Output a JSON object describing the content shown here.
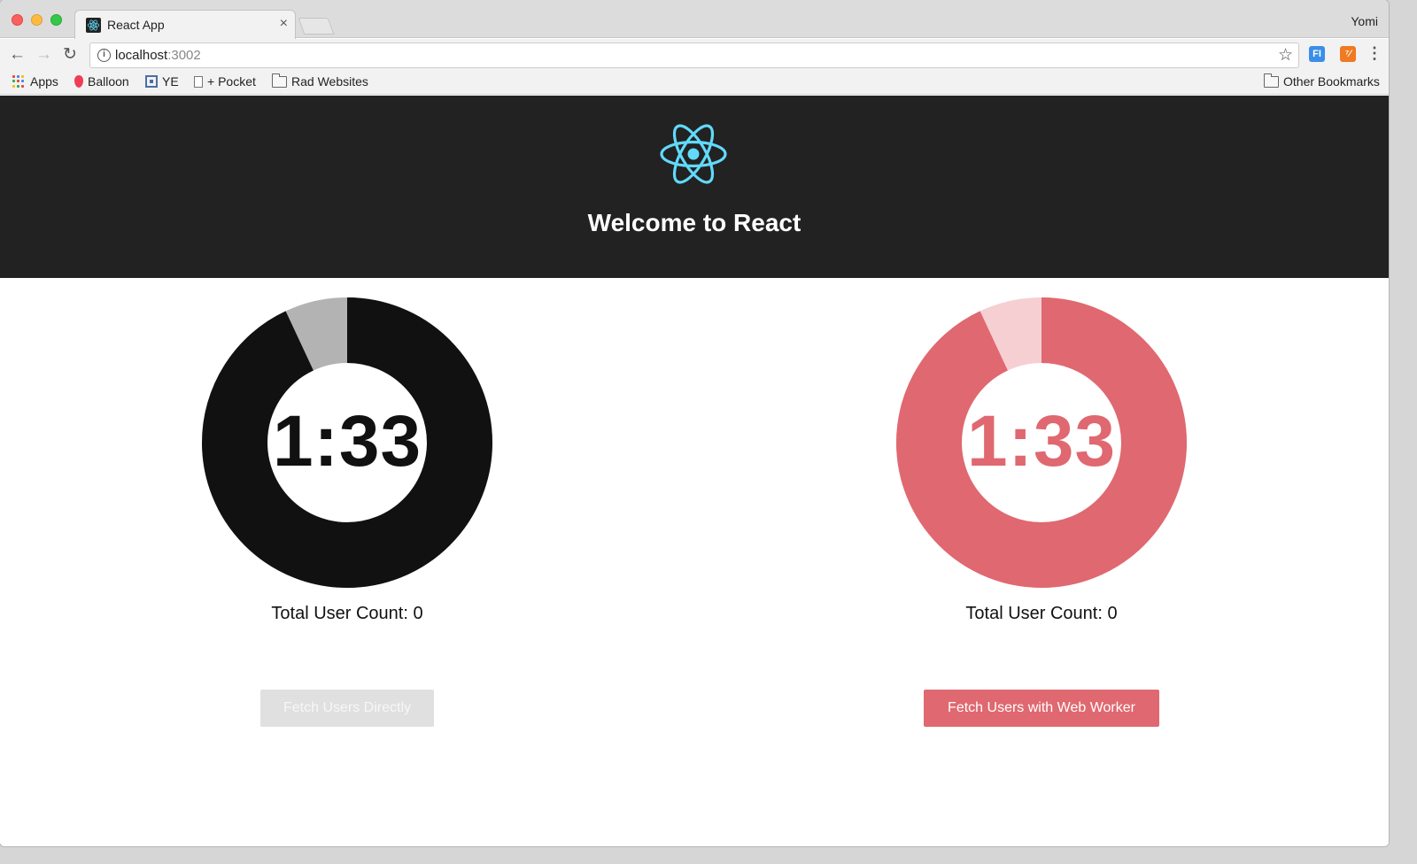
{
  "browser": {
    "tab_title": "React App",
    "tab_close": "×",
    "profile_name": "Yomi",
    "url_host": "localhost",
    "url_port": ":3002",
    "bookmarks": {
      "apps": "Apps",
      "balloon": "Balloon",
      "ye": "YE",
      "pocket": "+ Pocket",
      "rad_websites": "Rad Websites",
      "other_bookmarks": "Other Bookmarks"
    },
    "icons": {
      "back": "←",
      "forward": "→",
      "reload": "↻",
      "star": "☆",
      "menu": "⋮",
      "ext1": "FI",
      "ext2": "⁷⁄"
    }
  },
  "app": {
    "header_title": "Welcome to React",
    "logo_color": "#61dafb",
    "header_bg": "#222222",
    "left_panel": {
      "timer": "1:33",
      "elapsed_fraction": 0.07,
      "count_label": "Total User Count: 0",
      "button_label": "Fetch Users Directly",
      "button_disabled": true,
      "ring_color": "#111111",
      "track_color": "#b3b3b3",
      "timer_color": "#111111"
    },
    "right_panel": {
      "timer": "1:33",
      "elapsed_fraction": 0.07,
      "count_label": "Total User Count: 0",
      "button_label": "Fetch Users with Web Worker",
      "button_disabled": false,
      "ring_color": "#e06870",
      "track_color": "#f6cfd2",
      "timer_color": "#e06870"
    }
  }
}
